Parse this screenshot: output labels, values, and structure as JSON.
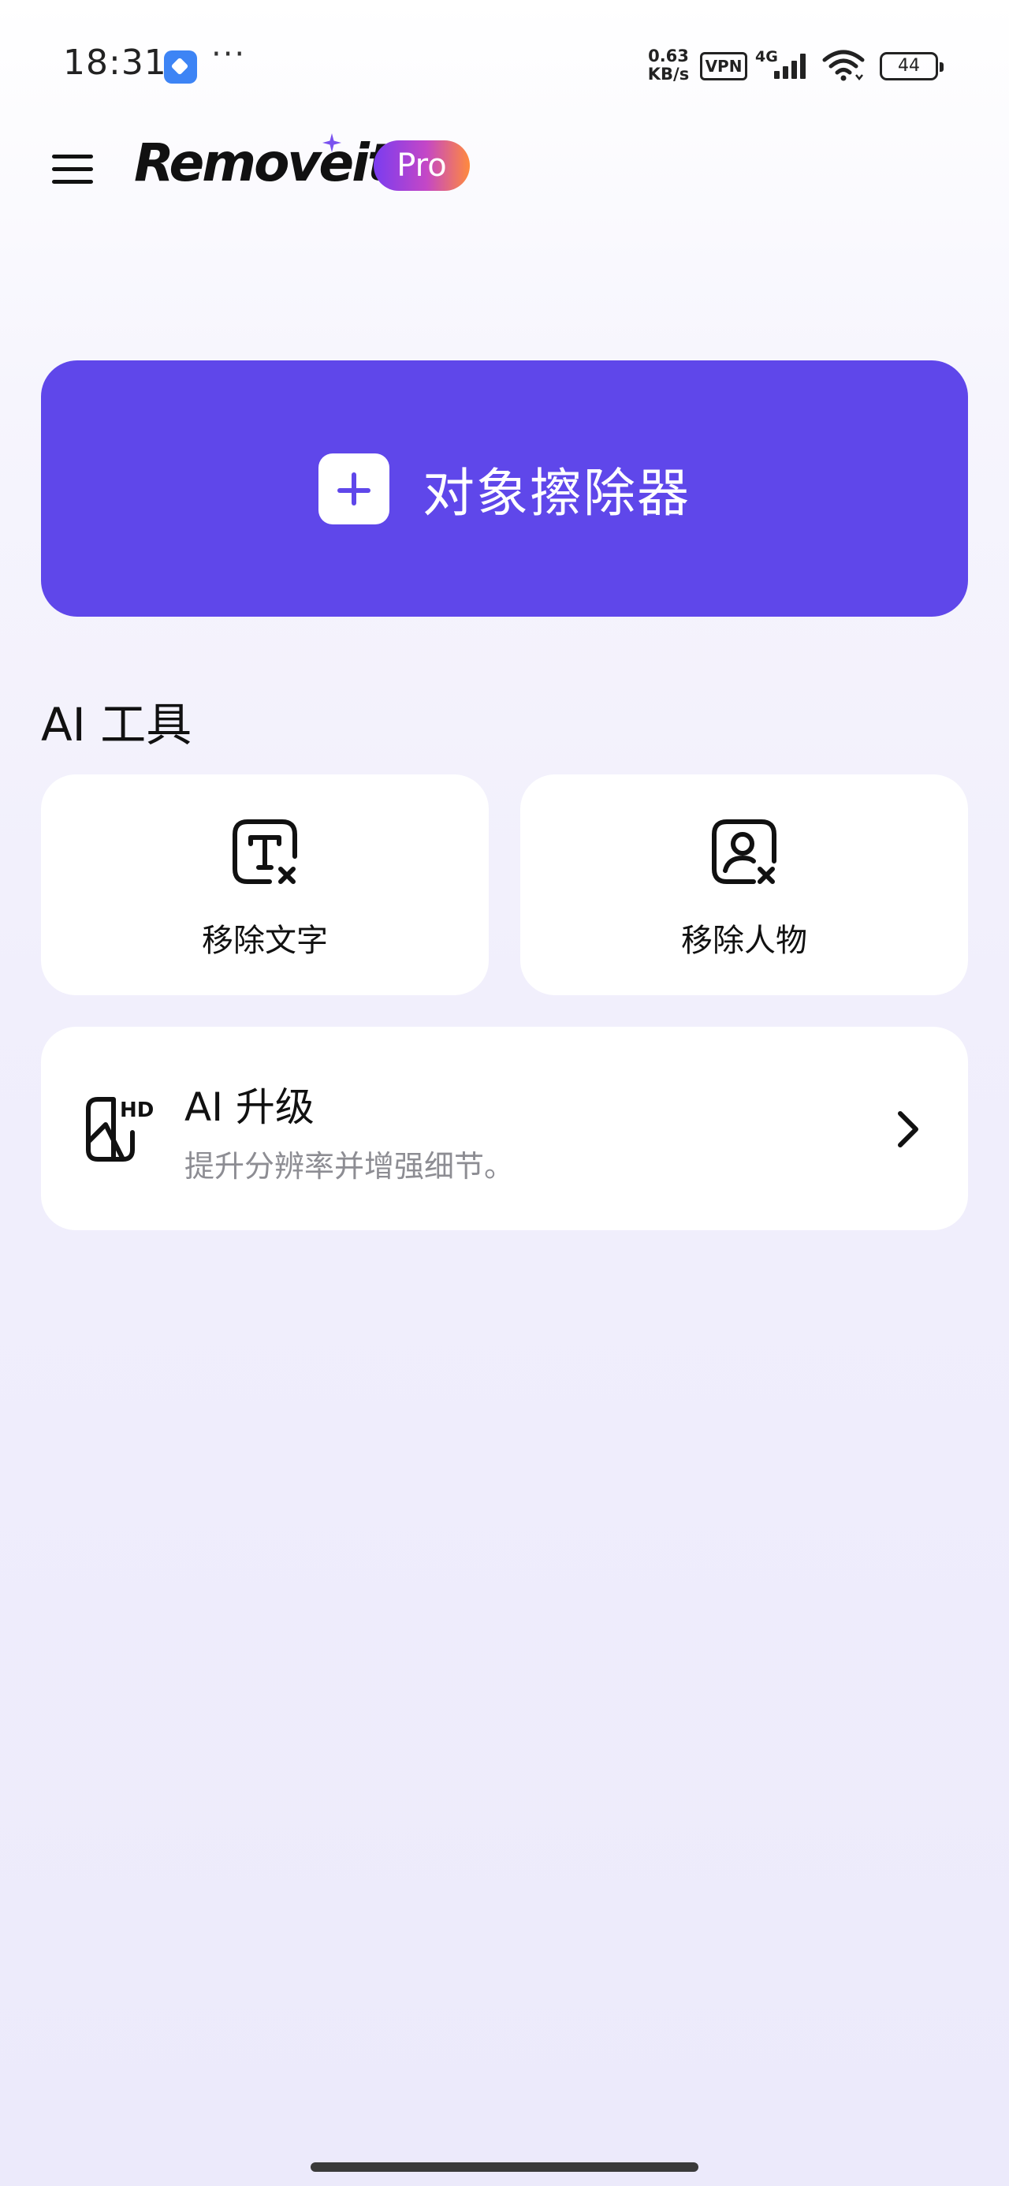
{
  "status_bar": {
    "time": "18:31",
    "more": "···",
    "net_speed_value": "0.63",
    "net_speed_unit": "KB/s",
    "vpn": "VPN",
    "network": "4G",
    "battery": "44"
  },
  "header": {
    "app_name": "Removeit",
    "badge": "Pro"
  },
  "main": {
    "eraser_label": "对象擦除器"
  },
  "ai_tools": {
    "title": "AI 工具",
    "tools": [
      {
        "label": "移除文字",
        "icon": "remove-text-icon"
      },
      {
        "label": "移除人物",
        "icon": "remove-person-icon"
      }
    ],
    "upgrade": {
      "title": "AI 升级",
      "description": "提升分辨率并增强细节。",
      "icon": "hd-upscale-icon"
    }
  },
  "colors": {
    "accent": "#5f47ea",
    "badge_gradient_start": "#7a3cf0",
    "badge_gradient_end": "#ff8a3d",
    "muted_text": "#8d8d93"
  }
}
